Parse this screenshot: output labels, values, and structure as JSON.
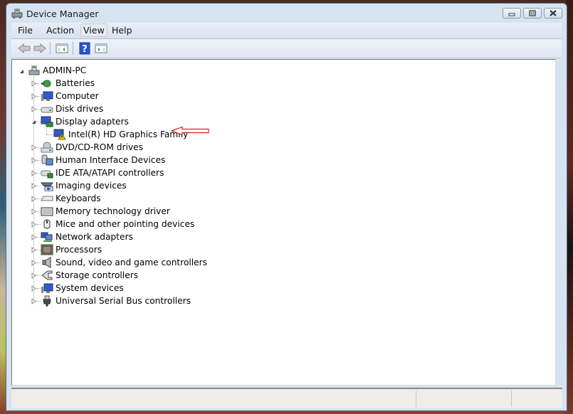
{
  "window": {
    "title": "Device Manager",
    "controls": [
      "minimize",
      "maximize",
      "close"
    ]
  },
  "menu": {
    "items": [
      "File",
      "Action",
      "View",
      "Help"
    ]
  },
  "toolbar": {
    "buttons": [
      "back-arrow",
      "forward-arrow",
      "show-hide-console-tree",
      "help",
      "show-action-pane"
    ]
  },
  "tree": {
    "root": "ADMIN-PC",
    "categories": [
      {
        "label": "Batteries",
        "icon": "battery-icon",
        "expanded": false
      },
      {
        "label": "Computer",
        "icon": "computer-icon",
        "expanded": false
      },
      {
        "label": "Disk drives",
        "icon": "disk-drive-icon",
        "expanded": false
      },
      {
        "label": "Display adapters",
        "icon": "display-adapter-icon",
        "expanded": true,
        "children": [
          {
            "label": "Intel(R) HD Graphics Family",
            "icon": "display-warning-icon",
            "status": "warning"
          }
        ]
      },
      {
        "label": "DVD/CD-ROM drives",
        "icon": "dvd-drive-icon",
        "expanded": false
      },
      {
        "label": "Human Interface Devices",
        "icon": "hid-icon",
        "expanded": false
      },
      {
        "label": "IDE ATA/ATAPI controllers",
        "icon": "ide-controller-icon",
        "expanded": false
      },
      {
        "label": "Imaging devices",
        "icon": "imaging-device-icon",
        "expanded": false
      },
      {
        "label": "Keyboards",
        "icon": "keyboard-icon",
        "expanded": false
      },
      {
        "label": "Memory technology driver",
        "icon": "memory-icon",
        "expanded": false
      },
      {
        "label": "Mice and other pointing devices",
        "icon": "mouse-icon",
        "expanded": false
      },
      {
        "label": "Network adapters",
        "icon": "network-adapter-icon",
        "expanded": false
      },
      {
        "label": "Processors",
        "icon": "processor-icon",
        "expanded": false
      },
      {
        "label": "Sound, video and game controllers",
        "icon": "speaker-icon",
        "expanded": false
      },
      {
        "label": "Storage controllers",
        "icon": "storage-controller-icon",
        "expanded": false
      },
      {
        "label": "System devices",
        "icon": "system-device-icon",
        "expanded": false
      },
      {
        "label": "Universal Serial Bus controllers",
        "icon": "usb-icon",
        "expanded": false
      }
    ]
  },
  "annotation": {
    "type": "red-arrow",
    "points_to": "Intel(R) HD Graphics Family",
    "color": "#d42020"
  },
  "statusbar": {
    "panes": [
      "",
      "",
      ""
    ]
  }
}
